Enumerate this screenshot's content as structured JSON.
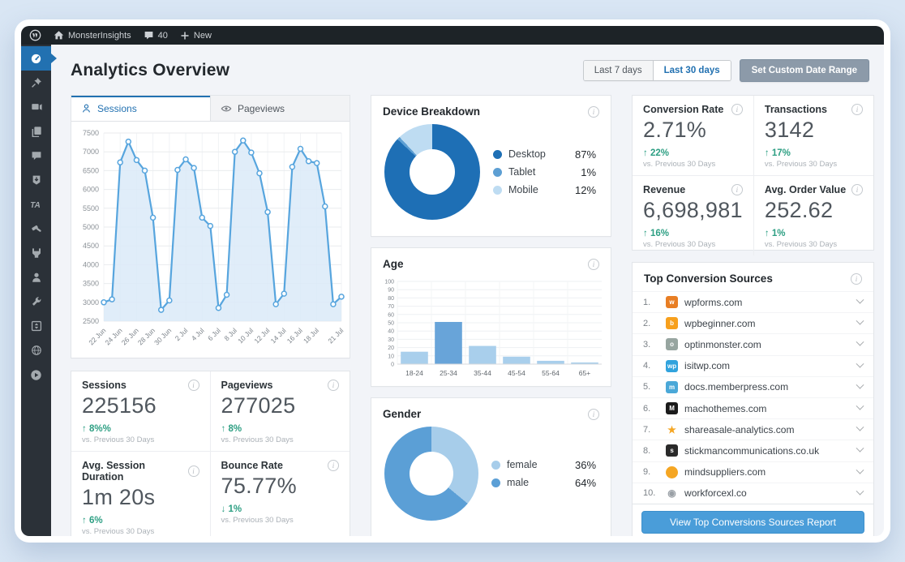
{
  "admin_bar": {
    "site_name": "MonsterInsights",
    "comments_count": "40",
    "new_label": "New"
  },
  "sidebar": {
    "items": [
      {
        "name": "menu-dashboard",
        "icon": "dashboard",
        "active": true
      },
      {
        "name": "menu-posts",
        "icon": "pin"
      },
      {
        "name": "menu-media",
        "icon": "media"
      },
      {
        "name": "menu-pages",
        "icon": "pages"
      },
      {
        "name": "menu-comments",
        "icon": "comments"
      },
      {
        "name": "menu-downloads",
        "icon": "download"
      },
      {
        "name": "menu-ta-plugin",
        "icon": "ta"
      },
      {
        "name": "menu-appearance",
        "icon": "hammer"
      },
      {
        "name": "menu-plugins",
        "icon": "plug"
      },
      {
        "name": "menu-users",
        "icon": "user"
      },
      {
        "name": "menu-tools",
        "icon": "wrench"
      },
      {
        "name": "menu-settings",
        "icon": "box"
      },
      {
        "name": "menu-network",
        "icon": "network"
      },
      {
        "name": "menu-video",
        "icon": "play"
      }
    ]
  },
  "page": {
    "title": "Analytics Overview"
  },
  "date_controls": {
    "last_7": "Last 7 days",
    "last_30": "Last 30 days",
    "custom": "Set Custom Date Range",
    "selected": "Last 30 days"
  },
  "tabs": {
    "sessions": "Sessions",
    "pageviews": "Pageviews",
    "active": "Sessions"
  },
  "chart_data": [
    {
      "id": "sessions_over_time",
      "type": "line",
      "title": "Sessions over time",
      "x": [
        "22 Jun",
        "23 Jun",
        "24 Jun",
        "25 Jun",
        "26 Jun",
        "27 Jun",
        "28 Jun",
        "29 Jun",
        "30 Jun",
        "1 Jul",
        "2 Jul",
        "3 Jul",
        "4 Jul",
        "5 Jul",
        "6 Jul",
        "7 Jul",
        "8 Jul",
        "9 Jul",
        "10 Jul",
        "11 Jul",
        "12 Jul",
        "13 Jul",
        "14 Jul",
        "15 Jul",
        "16 Jul",
        "17 Jul",
        "18 Jul",
        "19 Jul",
        "20 Jul",
        "21 Jul"
      ],
      "values": [
        3000,
        3080,
        6720,
        7270,
        6780,
        6500,
        5250,
        2800,
        3050,
        6520,
        6800,
        6570,
        5250,
        5030,
        2850,
        3200,
        7000,
        7300,
        6980,
        6430,
        5400,
        2950,
        3230,
        6600,
        7080,
        6750,
        6700,
        5550,
        2950,
        3150
      ],
      "ylim": [
        2500,
        7500
      ],
      "ytick_step": 500,
      "xtick_indices": [
        0,
        2,
        4,
        6,
        8,
        10,
        12,
        14,
        16,
        18,
        20,
        22,
        24,
        26,
        29
      ],
      "xtick_labels": [
        "22 Jun",
        "24 Jun",
        "26 Jun",
        "28 Jun",
        "30 Jun",
        "2 Jul",
        "4 Jul",
        "6 Jul",
        "8 Jul",
        "10 Jul",
        "12 Jul",
        "14 Jul",
        "16 Jul",
        "18 Jul",
        "21 Jul"
      ],
      "grid": true,
      "legend_position": "none",
      "line_color": "#57a5de",
      "fill_color": "#daeaf8"
    },
    {
      "id": "device_breakdown",
      "type": "pie",
      "title": "Device Breakdown",
      "labels": [
        "Desktop",
        "Tablet",
        "Mobile"
      ],
      "values": [
        87,
        1,
        12
      ],
      "display": [
        "87%",
        "1%",
        "12%"
      ],
      "colors": [
        "#1e6fb5",
        "#5d9fd3",
        "#bedcf2"
      ],
      "legend_position": "right"
    },
    {
      "id": "age",
      "type": "bar",
      "title": "Age",
      "categories": [
        "18-24",
        "25-34",
        "35-44",
        "45-54",
        "55-64",
        "65+"
      ],
      "values": [
        15,
        51,
        22,
        9,
        4,
        2
      ],
      "ylim": [
        0,
        100
      ],
      "ytick_step": 10,
      "grid": true,
      "bar_color": "#a9cfec",
      "highlight_color": "#68a4d9",
      "highlight_index": 1,
      "xlabel": "",
      "ylabel": ""
    },
    {
      "id": "gender",
      "type": "pie",
      "title": "Gender",
      "labels": [
        "female",
        "male"
      ],
      "values": [
        36,
        64
      ],
      "display": [
        "36%",
        "64%"
      ],
      "colors": [
        "#a7cdea",
        "#5b9fd6"
      ],
      "legend_position": "right"
    }
  ],
  "kpi_left": [
    {
      "label": "Sessions",
      "value": "225156",
      "direction": "up",
      "change": "8%%",
      "note": "vs. Previous 30 Days"
    },
    {
      "label": "Pageviews",
      "value": "277025",
      "direction": "up",
      "change": "8%",
      "note": "vs. Previous 30 Days"
    },
    {
      "label": "Avg. Session Duration",
      "value": "1m 20s",
      "direction": "up",
      "change": "6%",
      "note": "vs. Previous 30 Days"
    },
    {
      "label": "Bounce Rate",
      "value": "75.77%",
      "direction": "down",
      "change": "1%",
      "note": "vs. Previous 30 Days"
    }
  ],
  "kpi_right": [
    {
      "label": "Conversion Rate",
      "value": "2.71%",
      "direction": "up",
      "change": "22%",
      "note": "vs. Previous 30 Days"
    },
    {
      "label": "Transactions",
      "value": "3142",
      "direction": "up",
      "change": "17%",
      "note": "vs. Previous 30 Days"
    },
    {
      "label": "Revenue",
      "value": "6,698,981",
      "direction": "up",
      "change": "16%",
      "note": "vs. Previous 30 Days"
    },
    {
      "label": "Avg. Order Value",
      "value": "252.62",
      "direction": "up",
      "change": "1%",
      "note": "vs. Previous 30 Days"
    }
  ],
  "top_sources": {
    "title": "Top Conversion Sources",
    "items": [
      {
        "domain": "wpforms.com",
        "icon": {
          "bg": "#e87e24",
          "text": "w",
          "fg": "#fff"
        }
      },
      {
        "domain": "wpbeginner.com",
        "icon": {
          "bg": "#f7a01d",
          "text": "b",
          "fg": "#fff"
        }
      },
      {
        "domain": "optinmonster.com",
        "icon": {
          "bg": "#97a5a0",
          "text": "o",
          "fg": "#fff"
        }
      },
      {
        "domain": "isitwp.com",
        "icon": {
          "bg": "#31a3dd",
          "text": "wp",
          "fg": "#fff"
        }
      },
      {
        "domain": "docs.memberpress.com",
        "icon": {
          "bg": "#4aa8d8",
          "text": "m",
          "fg": "#fff"
        }
      },
      {
        "domain": "machothemes.com",
        "icon": {
          "bg": "#1b1b1b",
          "text": "M",
          "fg": "#fff"
        }
      },
      {
        "domain": "shareasale-analytics.com",
        "icon": {
          "bg": "transparent",
          "text": "★",
          "fg": "#f5a623"
        }
      },
      {
        "domain": "stickmancommunications.co.uk",
        "icon": {
          "bg": "#2a2a2a",
          "text": "s",
          "fg": "#fff"
        }
      },
      {
        "domain": "mindsuppliers.com",
        "icon": {
          "bg": "#f5a623",
          "text": "",
          "fg": "#fff",
          "round": true
        }
      },
      {
        "domain": "workforcexl.co",
        "icon": {
          "bg": "transparent",
          "text": "◉",
          "fg": "#9aa0a6"
        }
      }
    ],
    "button_label": "View Top Conversions Sources Report"
  },
  "colors": {
    "accent": "#2271b1",
    "green": "#2d9f83",
    "line_blue": "#57a5de",
    "button_blue": "#4a9dd9"
  }
}
